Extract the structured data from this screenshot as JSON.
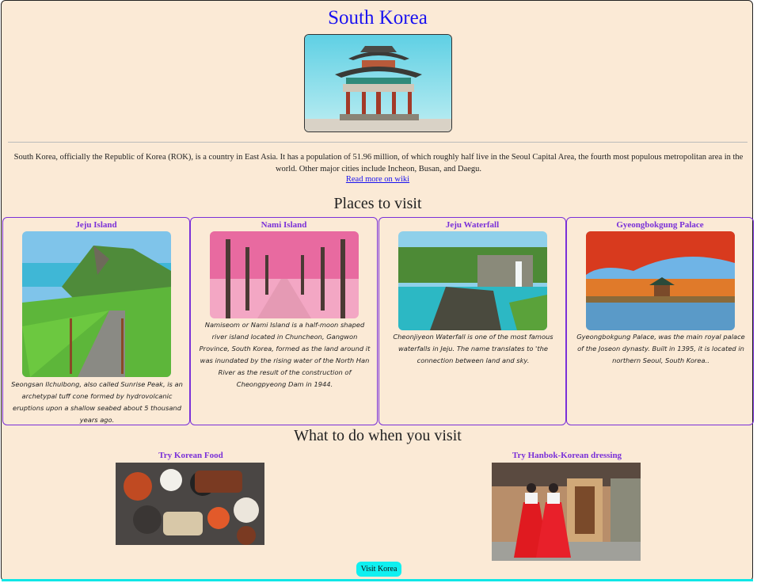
{
  "page": {
    "title": "South Korea",
    "intro": "South Korea, officially the Republic of Korea (ROK), is a country in East Asia. It has a population of 51.96 million, of which roughly half live in the Seoul Capital Area, the fourth most populous metropolitan area in the world. Other major cities include Incheon, Busan, and Daegu.",
    "wiki_link": "Read more on wiki"
  },
  "places": {
    "heading": "Places to visit",
    "items": [
      {
        "title": "Jeju Island",
        "text": "Seongsan Ilchulbong, also called Sunrise Peak, is an archetypal tuff cone formed by hydrovolcanic eruptions upon a shallow seabed about 5 thousand years ago."
      },
      {
        "title": "Nami Island",
        "text": "Namiseom or Nami Island is a half-moon shaped river island located in Chuncheon, Gangwon Province, South Korea, formed as the land around it was inundated by the rising water of the North Han River as the result of the construction of Cheongpyeong Dam in 1944."
      },
      {
        "title": "Jeju Waterfall",
        "text": "Cheonjiyeon Waterfall is one of the most famous waterfalls in Jeju. The name translates to 'the connection between land and sky."
      },
      {
        "title": "Gyeongbokgung Palace",
        "text": "Gyeongbokgung Palace, was the main royal palace of the Joseon dynasty. Built in 1395, it is located in northern Seoul, South Korea.."
      }
    ]
  },
  "todo": {
    "heading": "What to do when you visit",
    "items": [
      {
        "title": "Try Korean Food"
      },
      {
        "title": "Try Hanbok-Korean dressing"
      }
    ]
  },
  "visit_button": "Visit Korea"
}
